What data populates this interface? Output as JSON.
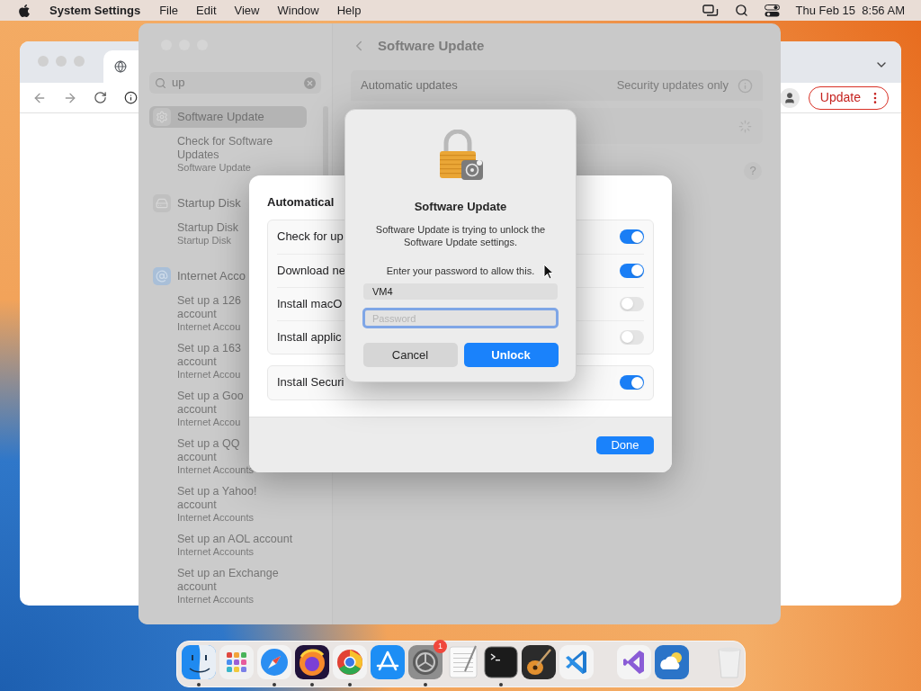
{
  "menu_bar": {
    "app": "System Settings",
    "menus": [
      "File",
      "Edit",
      "View",
      "Window",
      "Help"
    ],
    "clock": "Thu Feb 15  8:56 AM"
  },
  "browser": {
    "update_button": "Update"
  },
  "settings": {
    "search": {
      "value": "up"
    },
    "results": [
      {
        "kind": "update",
        "title": "Software Update",
        "selected": true,
        "items": [
          {
            "lines": [
              "Check for Software",
              "Updates"
            ],
            "subtitle": "Software Update"
          }
        ]
      },
      {
        "kind": "disk",
        "title": "Startup Disk",
        "selected": false,
        "items": [
          {
            "lines": [
              "Startup Disk"
            ],
            "subtitle": "Startup Disk"
          }
        ]
      },
      {
        "kind": "accounts",
        "title": "Internet Acco",
        "selected": false,
        "items": [
          {
            "lines": [
              "Set up a 126",
              "account"
            ],
            "subtitle": "Internet Accou"
          },
          {
            "lines": [
              "Set up a 163",
              "account"
            ],
            "subtitle": "Internet Accou"
          },
          {
            "lines": [
              "Set up a Goo",
              "account"
            ],
            "subtitle": "Internet Accou"
          },
          {
            "lines": [
              "Set up a QQ",
              "account"
            ],
            "subtitle": "Internet Accounts"
          },
          {
            "lines": [
              "Set up a Yahoo!",
              "account"
            ],
            "subtitle": "Internet Accounts"
          },
          {
            "lines": [
              "Set up an AOL account"
            ],
            "subtitle": "Internet Accounts"
          },
          {
            "lines": [
              "Set up an Exchange",
              "account"
            ],
            "subtitle": "Internet Accounts"
          }
        ]
      }
    ],
    "header": "Software Update",
    "auto_row": {
      "label": "Automatic updates",
      "value": "Security updates only"
    },
    "help": "?"
  },
  "sheet": {
    "title": "Automatical",
    "groups": [
      {
        "rows": [
          {
            "label": "Check for up",
            "on": true
          },
          {
            "label": "Download ne",
            "on": true
          },
          {
            "label": "Install macO",
            "on": false
          },
          {
            "label": "Install applic",
            "on": false
          }
        ]
      },
      {
        "rows": [
          {
            "label": "Install Securi",
            "on": true
          }
        ]
      }
    ],
    "done": "Done"
  },
  "dialog": {
    "title": "Software Update",
    "message": "Software Update is trying to unlock the Software Update settings.",
    "prompt": "Enter your password to allow this.",
    "username": "VM4",
    "password_placeholder": "Password",
    "buttons": [
      {
        "label": "Cancel",
        "kind": "secondary"
      },
      {
        "label": "Unlock",
        "kind": "primary"
      }
    ]
  },
  "dock": [
    {
      "kind": "finder",
      "running": true
    },
    {
      "kind": "launchpad",
      "running": false
    },
    {
      "kind": "safari",
      "running": true
    },
    {
      "kind": "firefox",
      "running": true
    },
    {
      "kind": "chrome",
      "running": true
    },
    {
      "kind": "appstore",
      "running": false
    },
    {
      "kind": "settings",
      "running": true,
      "badge": "1"
    },
    {
      "kind": "textedit",
      "running": false
    },
    {
      "kind": "terminal",
      "running": true
    },
    {
      "kind": "garageband",
      "running": false
    },
    {
      "kind": "vscode",
      "running": false
    },
    {
      "kind": "separator"
    },
    {
      "kind": "visualstudio",
      "running": false
    },
    {
      "kind": "weather",
      "running": false
    },
    {
      "kind": "separator"
    },
    {
      "kind": "trash",
      "running": false
    }
  ]
}
